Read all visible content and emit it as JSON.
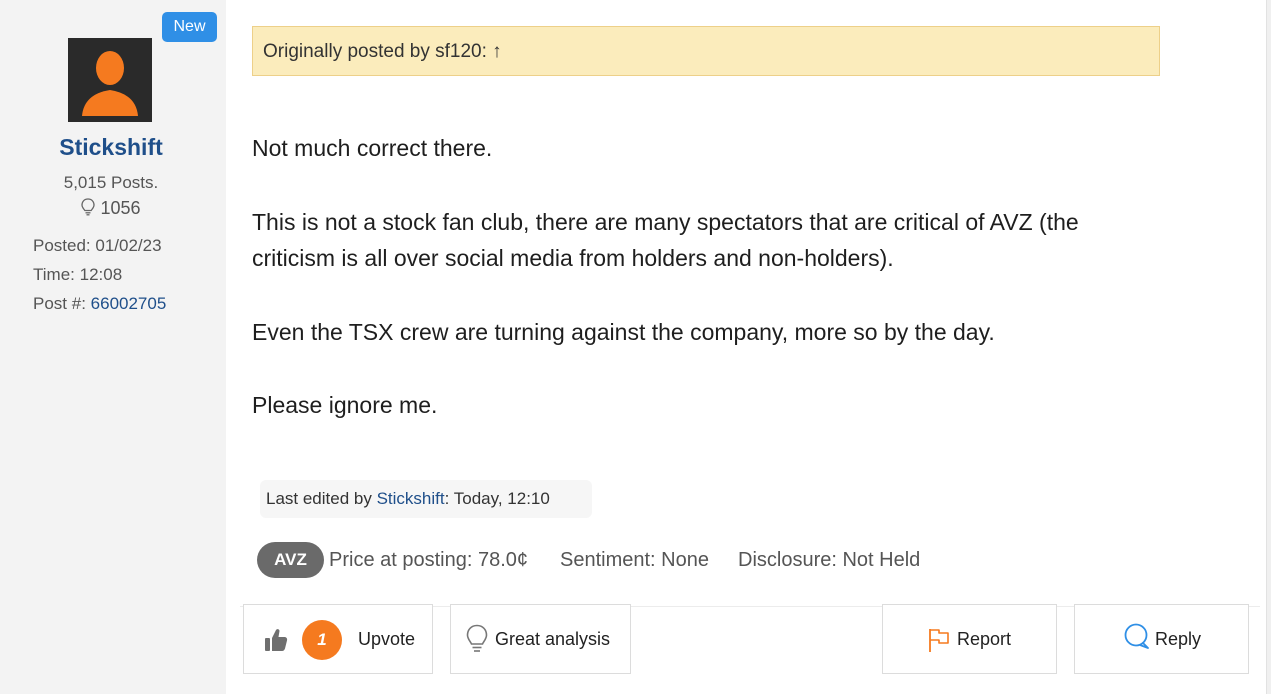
{
  "author": {
    "badge": "New",
    "username": "Stickshift",
    "posts": "5,015 Posts.",
    "reputation": "1056",
    "posted_label": "Posted:",
    "posted_date": "01/02/23",
    "time_label": "Time:",
    "time": "12:08",
    "post_num_label": "Post #:",
    "post_num": "66002705"
  },
  "quote": {
    "text": "Originally posted by sf120: ↑"
  },
  "body": {
    "paragraphs": [
      "Not much correct there.",
      "This is not a stock fan club, there are many spectators that are critical of AVZ (the",
      "criticism is all over social media from holders and non-holders).",
      "Even the TSX crew are turning against the company, more so by the day.",
      "Please ignore me."
    ]
  },
  "edit": {
    "prefix": "Last edited by ",
    "editor": "Stickshift",
    "suffix": ": Today, 12:10"
  },
  "stock": {
    "ticker": "AVZ",
    "price": "Price at posting: 78.0¢",
    "sentiment": "Sentiment: None",
    "disclosure": "Disclosure: Not Held"
  },
  "actions": {
    "upvote_count": "1",
    "upvote_label": "Upvote",
    "great_analysis_label": "Great analysis",
    "report_label": "Report",
    "reply_label": "Reply"
  },
  "colors": {
    "accent_orange": "#f57a1f",
    "link_blue": "#1f4f8a",
    "badge_blue": "#2f8fe6",
    "quote_bg": "#fbecbc"
  }
}
